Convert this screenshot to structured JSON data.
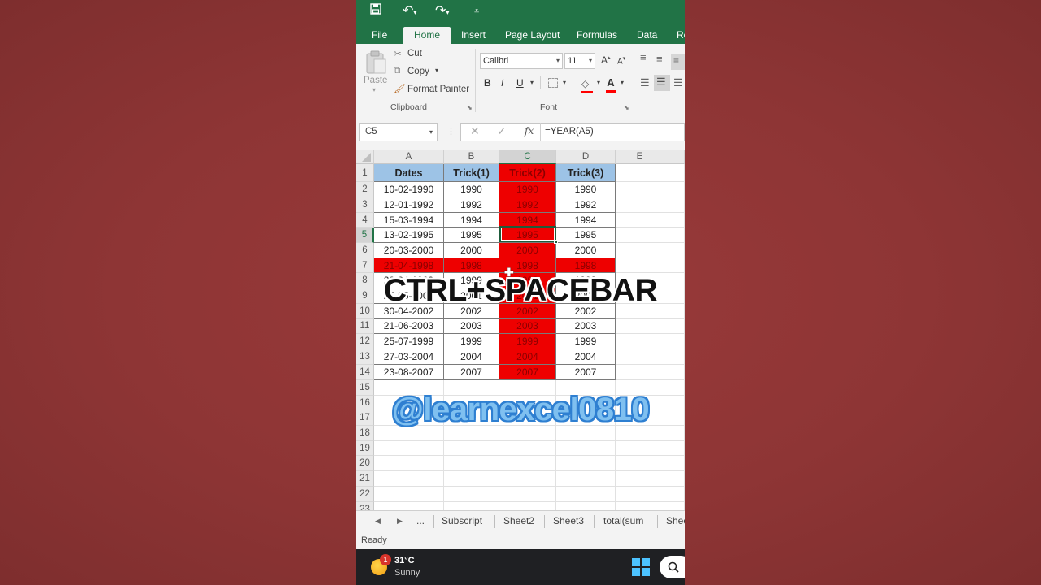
{
  "ribbon_tabs": [
    "File",
    "Home",
    "Insert",
    "Page Layout",
    "Formulas",
    "Data",
    "Re"
  ],
  "clipboard": {
    "paste": "Paste",
    "cut": "Cut",
    "copy": "Copy",
    "format_painter": "Format Painter",
    "group": "Clipboard"
  },
  "font": {
    "name": "Calibri",
    "size": "11",
    "bold": "B",
    "italic": "I",
    "underline": "U",
    "group": "Font"
  },
  "formula_bar": {
    "name_box": "C5",
    "formula": "=YEAR(A5)"
  },
  "columns": [
    "A",
    "B",
    "C",
    "D",
    "E"
  ],
  "rows": [
    "1",
    "2",
    "3",
    "4",
    "5",
    "6",
    "7",
    "8",
    "9",
    "10",
    "11",
    "12",
    "13",
    "14",
    "15",
    "16",
    "17",
    "18",
    "19",
    "20",
    "21",
    "22",
    "23"
  ],
  "table": {
    "headers": [
      "Dates",
      "Trick(1)",
      "Trick(2)",
      "Trick(3)"
    ],
    "data": [
      [
        "10-02-1990",
        "1990",
        "1990",
        "1990"
      ],
      [
        "12-01-1992",
        "1992",
        "1992",
        "1992"
      ],
      [
        "15-03-1994",
        "1994",
        "1994",
        "1994"
      ],
      [
        "13-02-1995",
        "1995",
        "1995",
        "1995"
      ],
      [
        "20-03-2000",
        "2000",
        "2000",
        "2000"
      ],
      [
        "21-04-1998",
        "1998",
        "1998",
        "1998"
      ],
      [
        "20-04-1999",
        "1999",
        "1999",
        "1999"
      ],
      [
        "25-05-2001",
        "2001",
        "2001",
        "2001"
      ],
      [
        "30-04-2002",
        "2002",
        "2002",
        "2002"
      ],
      [
        "21-06-2003",
        "2003",
        "2003",
        "2003"
      ],
      [
        "25-07-1999",
        "1999",
        "1999",
        "1999"
      ],
      [
        "27-03-2004",
        "2004",
        "2004",
        "2004"
      ],
      [
        "23-08-2007",
        "2007",
        "2007",
        "2007"
      ]
    ]
  },
  "sheet_tabs": [
    "...",
    "Subscript",
    "Sheet2",
    "Sheet3",
    "total(sum",
    "Shee"
  ],
  "status": "Ready",
  "weather": {
    "temp": "31°C",
    "condition": "Sunny",
    "badge": "1"
  },
  "overlay": {
    "shortcut": "CTRL+SPACEBAR",
    "handle": "@learnexcel0810"
  },
  "colors": {
    "excel_green": "#217346",
    "highlight_red": "#ee0000",
    "header_blue": "#9dc3e6"
  }
}
